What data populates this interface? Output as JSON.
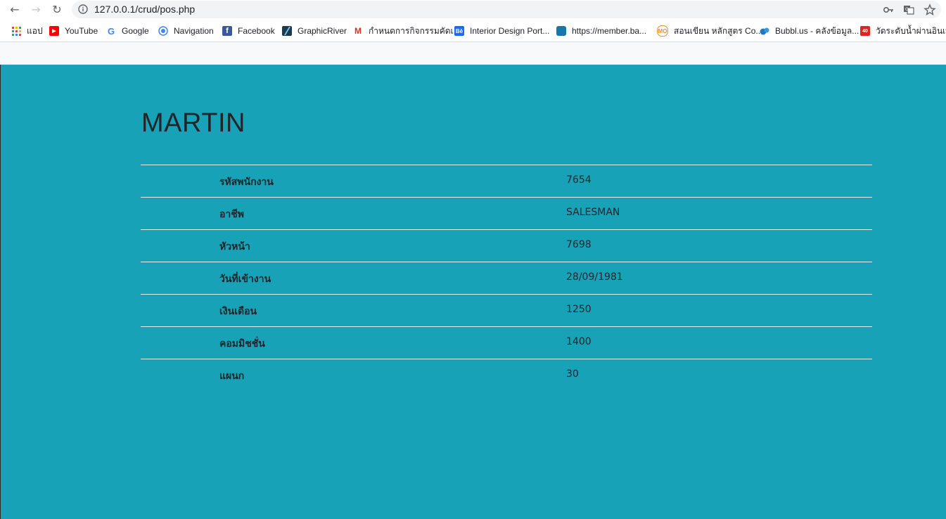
{
  "browser": {
    "url": "127.0.0.1/crud/pos.php",
    "bookmarks": [
      {
        "label": "แอป",
        "icon": "apps-grid-icon"
      },
      {
        "label": "YouTube",
        "icon": "youtube-icon"
      },
      {
        "label": "Google",
        "icon": "google-icon"
      },
      {
        "label": "Navigation",
        "icon": "navigation-icon"
      },
      {
        "label": "Facebook",
        "icon": "facebook-icon"
      },
      {
        "label": "GraphicRiver",
        "icon": "graphicriver-icon"
      },
      {
        "label": "กำหนดการกิจกรรมคัดเ...",
        "icon": "gmail-icon"
      },
      {
        "label": "Interior Design Port...",
        "icon": "behance-icon"
      },
      {
        "label": "https://member.ba...",
        "icon": "member-site-icon"
      },
      {
        "label": "สอนเขียน หลักสูตร Co...",
        "icon": "course-site-icon"
      },
      {
        "label": "Bubbl.us - คลังข้อมูล...",
        "icon": "bubblus-icon"
      },
      {
        "label": "วัดระดับน้ำผ่านอินเทอร์...",
        "icon": "water-level-icon"
      }
    ]
  },
  "page": {
    "title": "MARTIN",
    "rows": [
      {
        "label": "รหัสพนักงาน",
        "value": "7654"
      },
      {
        "label": "อาชีพ",
        "value": "SALESMAN"
      },
      {
        "label": "หัวหน้า",
        "value": "7698"
      },
      {
        "label": "วันที่เข้างาน",
        "value": "28/09/1981"
      },
      {
        "label": "เงินเดือน",
        "value": "1250"
      },
      {
        "label": "คอมมิชชั่น",
        "value": "1400"
      },
      {
        "label": "แผนก",
        "value": "30"
      }
    ]
  },
  "colors": {
    "page_background": "#17a2b8",
    "navbar_background": "#f8f9fa",
    "text": "#212529"
  }
}
